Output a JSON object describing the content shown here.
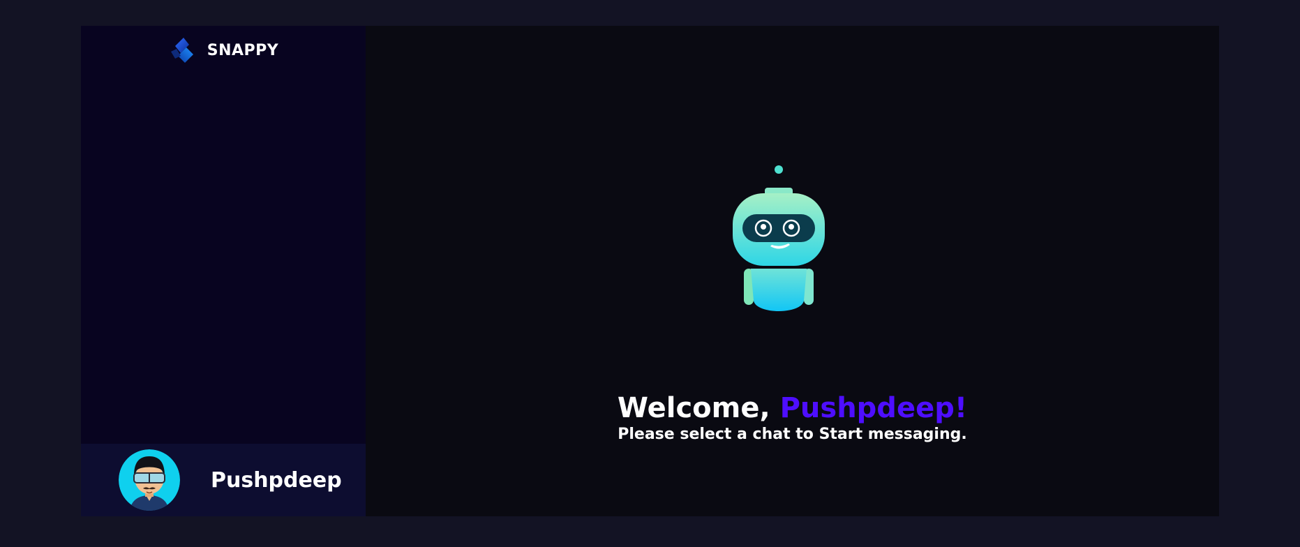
{
  "brand": {
    "name": "SNAPPY",
    "logo_icon": "snappy-logo-icon"
  },
  "current_user": {
    "name": "Pushpdeep",
    "avatar_icon": "user-avatar-icon"
  },
  "welcome": {
    "greeting": "Welcome,",
    "name": "Pushpdeep!",
    "subtitle": "Please select a chat to Start messaging.",
    "illustration_icon": "robot-icon"
  },
  "colors": {
    "page_background": "#131324",
    "sidebar_background": "#080420",
    "user_panel_background": "#0d0d30",
    "main_background": "#0a0a12",
    "accent": "#4e0eff",
    "text": "#ffffff"
  }
}
